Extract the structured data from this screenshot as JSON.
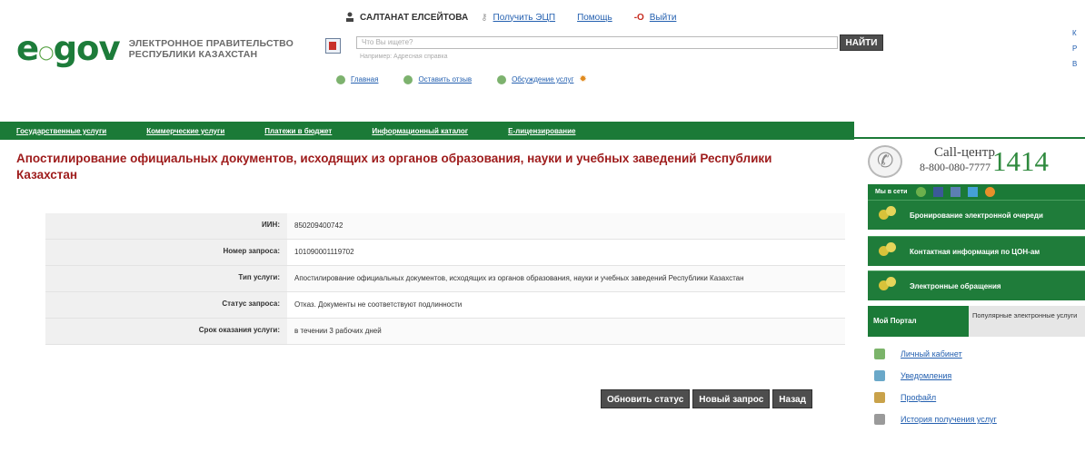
{
  "header": {
    "logo_mark_prefix": "e",
    "logo_mark_mid": "○",
    "logo_mark_suffix": "gov",
    "logo_line1": "ЭЛЕКТРОННОЕ ПРАВИТЕЛЬСТВО",
    "logo_line2": "РЕСПУБЛИКИ КАЗАХСТАН",
    "user_name": "САЛТАНАТ ЕЛСЕЙТОВА",
    "get_eds": "Получить ЭЦП",
    "help": "Помощь",
    "exit_mark": "-О",
    "exit": "Выйти",
    "search_placeholder": "Что Вы ищете?",
    "search_hint": "Например: Адресная справка",
    "find_button": "НАЙТИ",
    "link_home": "Главная",
    "link_feedback": "Оставить отзыв",
    "link_discuss": "Обсуждение услуг",
    "right_edge": [
      "К",
      "Р",
      "В"
    ]
  },
  "nav": {
    "items": [
      "Государственные услуги",
      "Коммерческие услуги",
      "Платежи в бюджет",
      "Информационный каталог",
      "Е-лицензирование"
    ]
  },
  "page": {
    "title": "Апостилирование официальных документов, исходящих из органов образования, науки и учебных заведений Республики Казахстан"
  },
  "info": {
    "rows": [
      {
        "label": "ИИН:",
        "value": "850209400742"
      },
      {
        "label": "Номер запроса:",
        "value": "101090001119702"
      },
      {
        "label": "Тип услуги:",
        "value": "Апостилирование официальных документов, исходящих из органов образования, науки и учебных заведений Республики Казахстан"
      },
      {
        "label": "Статус запроса:",
        "value": "Отказ. Документы не соответствуют подлинности"
      },
      {
        "label": "Срок оказания услуги:",
        "value": "в течении 3 рабочих дней"
      }
    ]
  },
  "actions": {
    "refresh": "Обновить статус",
    "new_request": "Новый запрос",
    "back": "Назад"
  },
  "sidebar": {
    "cc_label": "Call-центр",
    "cc_phone": "8-800-080-7777",
    "cc_number": "1414",
    "net_label": "Мы в сети",
    "green_rows": [
      "Бронирование электронной очереди",
      "Контактная информация по ЦОН-ам",
      "Электронные обращения"
    ],
    "tab_active": "Мой Портал",
    "tab_inactive": "Популярные электронные услуги",
    "portal_links": [
      "Личный кабинет",
      "Уведомления",
      "Профайл",
      "История получения услуг"
    ]
  },
  "colors": {
    "brand_green": "#1b7a37",
    "title_red": "#9e1b1b",
    "link_blue": "#2460b0",
    "button_dark": "#4e4e4e"
  }
}
